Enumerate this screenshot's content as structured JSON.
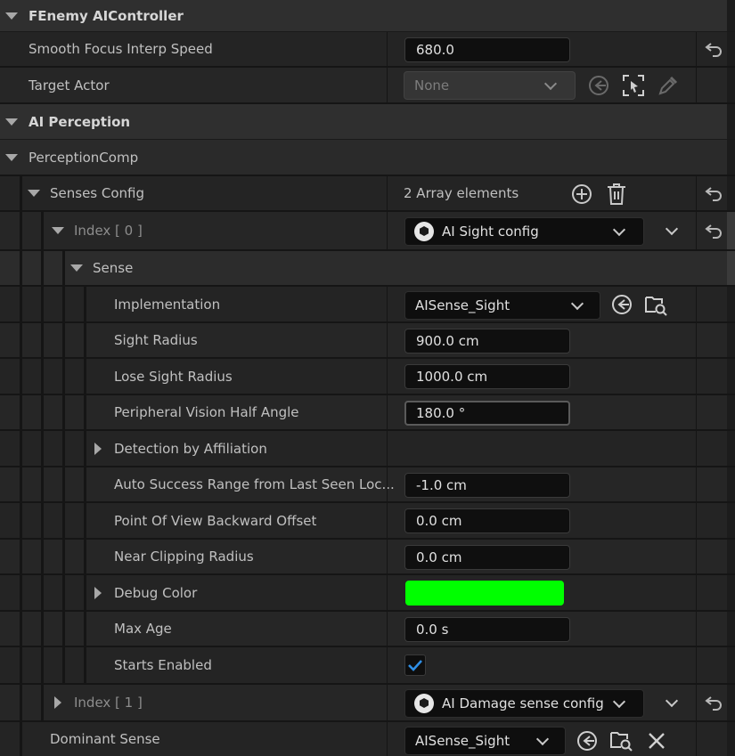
{
  "categories": {
    "fenemy": "FEnemy AIController",
    "ai_perception": "AI Perception",
    "perception_comp": "PerceptionComp"
  },
  "props": {
    "smooth_focus": {
      "label": "Smooth Focus Interp Speed",
      "value": "680.0"
    },
    "target_actor": {
      "label": "Target Actor",
      "value": "None"
    },
    "senses_config": {
      "label": "Senses Config",
      "value": "2 Array elements"
    },
    "index0": {
      "label": "Index [ 0 ]",
      "value": "AI Sight config"
    },
    "sense": {
      "label": "Sense"
    },
    "implementation": {
      "label": "Implementation",
      "value": "AISense_Sight"
    },
    "sight_radius": {
      "label": "Sight Radius",
      "value": "900.0 cm"
    },
    "lose_sight_radius": {
      "label": "Lose Sight Radius",
      "value": "1000.0 cm"
    },
    "peripheral": {
      "label": "Peripheral Vision Half Angle",
      "value": "180.0 °"
    },
    "detection": {
      "label": "Detection by Affiliation"
    },
    "auto_success": {
      "label": "Auto Success Range from Last Seen Loc...",
      "value": "-1.0 cm"
    },
    "pov_offset": {
      "label": "Point Of View Backward Offset",
      "value": "0.0 cm"
    },
    "near_clip": {
      "label": "Near Clipping Radius",
      "value": "0.0 cm"
    },
    "debug_color": {
      "label": "Debug Color",
      "color": "#00ff00"
    },
    "max_age": {
      "label": "Max Age",
      "value": "0.0 s"
    },
    "starts_enabled": {
      "label": "Starts Enabled",
      "checked": true
    },
    "index1": {
      "label": "Index [ 1 ]",
      "value": "AI Damage sense config"
    },
    "dominant_sense": {
      "label": "Dominant Sense",
      "value": "AISense_Sight"
    }
  },
  "icons": [
    "reset-arrow-icon",
    "use-selected-icon",
    "pick-actor-icon",
    "eyedropper-icon",
    "add-icon",
    "trash-icon",
    "browse-icon",
    "clear-icon",
    "checkmark-icon"
  ],
  "colors": {
    "accent_check": "#2f8fe6",
    "debug_color": "#00ff00"
  }
}
